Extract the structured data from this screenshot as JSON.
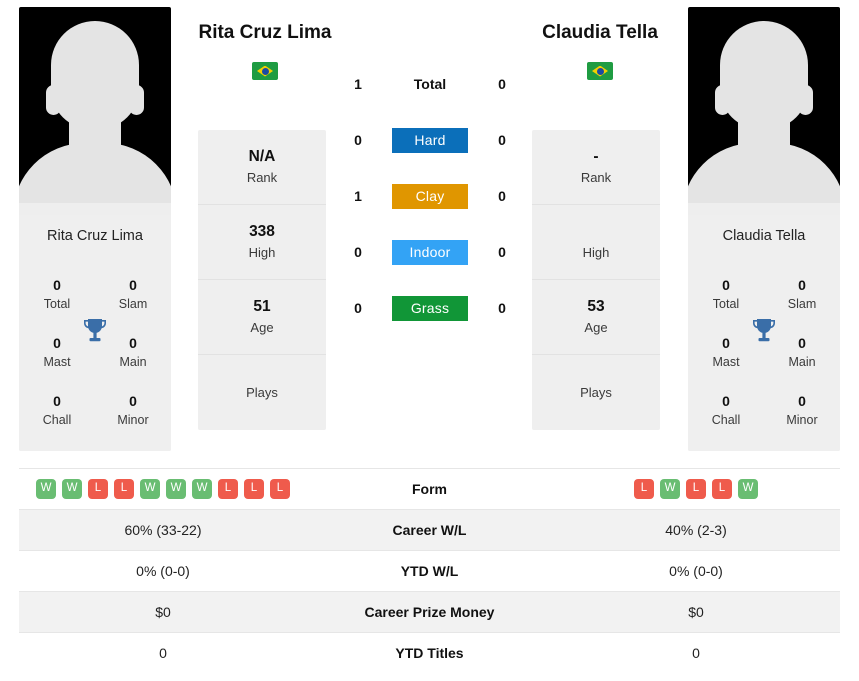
{
  "players": {
    "left": {
      "name": "Rita Cruz Lima",
      "country_flag": "brazil-flag",
      "photo_caption": "Rita Cruz Lima",
      "titles": {
        "total_value": "0",
        "total_label": "Total",
        "slam_value": "0",
        "slam_label": "Slam",
        "mast_value": "0",
        "mast_label": "Mast",
        "main_value": "0",
        "main_label": "Main",
        "chall_value": "0",
        "chall_label": "Chall",
        "minor_value": "0",
        "minor_label": "Minor"
      },
      "profile": {
        "rank_value": "N/A",
        "rank_label": "Rank",
        "high_value": "338",
        "high_label": "High",
        "age_value": "51",
        "age_label": "Age",
        "plays_value": "",
        "plays_label": "Plays"
      },
      "surface_wins": {
        "total": "1",
        "hard": "0",
        "clay": "1",
        "indoor": "0",
        "grass": "0"
      },
      "form": [
        "W",
        "W",
        "L",
        "L",
        "W",
        "W",
        "W",
        "L",
        "L",
        "L"
      ],
      "career_wl": "60% (33-22)",
      "ytd_wl": "0% (0-0)",
      "career_prize_money": "$0",
      "ytd_titles": "0"
    },
    "right": {
      "name": "Claudia Tella",
      "country_flag": "brazil-flag",
      "photo_caption": "Claudia Tella",
      "titles": {
        "total_value": "0",
        "total_label": "Total",
        "slam_value": "0",
        "slam_label": "Slam",
        "mast_value": "0",
        "mast_label": "Mast",
        "main_value": "0",
        "main_label": "Main",
        "chall_value": "0",
        "chall_label": "Chall",
        "minor_value": "0",
        "minor_label": "Minor"
      },
      "profile": {
        "rank_value": "-",
        "rank_label": "Rank",
        "high_value": "",
        "high_label": "High",
        "age_value": "53",
        "age_label": "Age",
        "plays_value": "",
        "plays_label": "Plays"
      },
      "surface_wins": {
        "total": "0",
        "hard": "0",
        "clay": "0",
        "indoor": "0",
        "grass": "0"
      },
      "form": [
        "L",
        "W",
        "L",
        "L",
        "W"
      ],
      "career_wl": "40% (2-3)",
      "ytd_wl": "0% (0-0)",
      "career_prize_money": "$0",
      "ytd_titles": "0"
    }
  },
  "surfaces": {
    "total_label": "Total",
    "hard_label": "Hard",
    "clay_label": "Clay",
    "indoor_label": "Indoor",
    "grass_label": "Grass",
    "hard_color": "#0b6fba",
    "clay_color": "#e09600",
    "indoor_color": "#33a3f5",
    "grass_color": "#119637"
  },
  "comparison_labels": {
    "form": "Form",
    "career_wl": "Career W/L",
    "ytd_wl": "YTD W/L",
    "career_prize_money": "Career Prize Money",
    "ytd_titles": "YTD Titles"
  },
  "colors": {
    "win_badge": "#69bd72",
    "loss_badge": "#ef5b4c",
    "trophy": "#3a6ea8",
    "card_bg": "#efefef"
  },
  "icons": {
    "trophy": "trophy-icon"
  }
}
